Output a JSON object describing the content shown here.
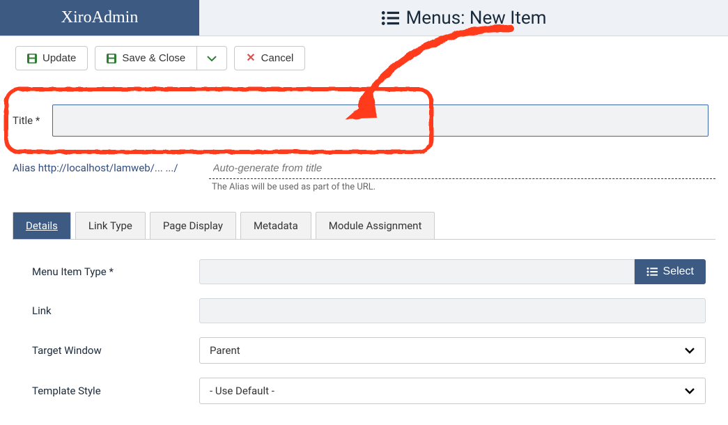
{
  "brand": "XiroAdmin",
  "page_title": "Menus: New Item",
  "toolbar": {
    "update": "Update",
    "save_close": "Save & Close",
    "cancel": "Cancel"
  },
  "title_field": {
    "label": "Title *",
    "value": ""
  },
  "alias": {
    "label": "Alias http://localhost/lamweb/... .../",
    "placeholder": "Auto-generate from title",
    "help": "The Alias will be used as part of the URL."
  },
  "tabs": [
    {
      "label": "Details",
      "active": true
    },
    {
      "label": "Link Type",
      "active": false
    },
    {
      "label": "Page Display",
      "active": false
    },
    {
      "label": "Metadata",
      "active": false
    },
    {
      "label": "Module Assignment",
      "active": false
    }
  ],
  "details": {
    "menu_item_type": {
      "label": "Menu Item Type *",
      "value": "",
      "select_btn": "Select"
    },
    "link": {
      "label": "Link",
      "value": ""
    },
    "target_window": {
      "label": "Target Window",
      "value": "Parent"
    },
    "template_style": {
      "label": "Template Style",
      "value": "- Use Default -"
    }
  },
  "annotations": {
    "highlight_color": "#ff3b1f",
    "arrow_color": "#ff3b1f"
  }
}
